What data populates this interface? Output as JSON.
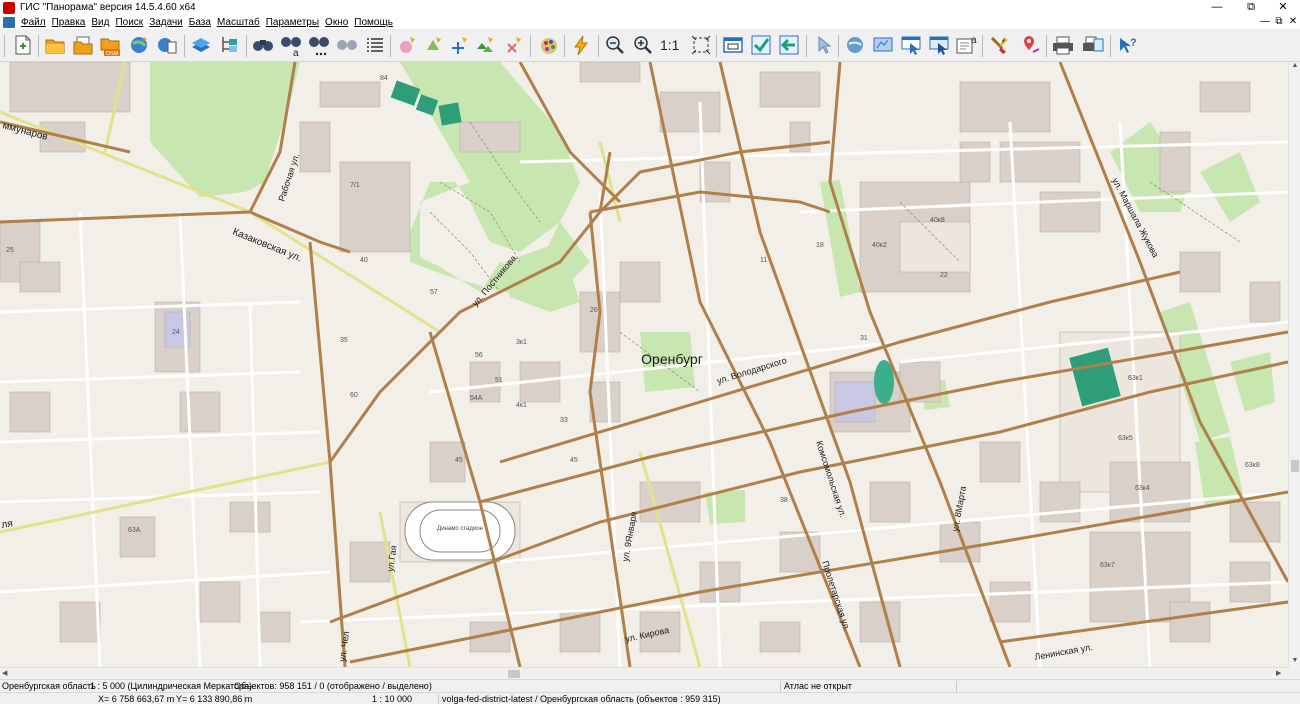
{
  "window": {
    "title": "ГИС \"Панорама\" версия 14.5.4.60 x64",
    "minimize": "—",
    "maximize": "⧉",
    "close": "✕"
  },
  "menu": {
    "items": [
      "Файл",
      "Правка",
      "Вид",
      "Поиск",
      "Задачи",
      "База",
      "Масштаб",
      "Параметры",
      "Окно",
      "Помощь"
    ],
    "child_minimize": "—",
    "child_restore": "⧉",
    "child_close": "✕"
  },
  "toolbar": {
    "zoom_one_to_one": "1:1",
    "osm_badge": "OSM",
    "icons": [
      "new-icon",
      "open-folder-icon",
      "open-folders-icon",
      "open-osm-icon",
      "globe-refresh-icon",
      "globe-docs-icon",
      "layers-icon",
      "legend-tree-icon",
      "search-binoculars-icon",
      "search-text-icon",
      "search-binoculars-dots-icon",
      "search-binoculars-grey-icon",
      "list-icon",
      "select-area-icon",
      "select-object-icon",
      "add-point-icon",
      "select-multiple-icon",
      "delete-object-icon",
      "palette-icon",
      "lightning-icon",
      "zoom-out-icon",
      "zoom-in-icon",
      "fit-window-icon",
      "window-frame-icon",
      "check-icon",
      "back-arrow-icon",
      "pointer-icon",
      "globe-arrows-icon",
      "map-arrow-icon",
      "pointer-window-icon",
      "pointer-window-blue-icon",
      "text-frame-icon",
      "brush-icon",
      "pin-route-icon",
      "print-icon",
      "print-preview-icon",
      "help-pointer-icon"
    ]
  },
  "map": {
    "city_label": "Оренбург",
    "streets": {
      "kommunarov": "ммунаров",
      "kazakovskaya": "Казаковская ул.",
      "rabochaya": "Рабочая ул.",
      "postnikova": "ул. Постникова",
      "volodarskogo": "ул. Володарского",
      "komsomolskaya": "Комсомольская ул.",
      "proletarskaya": "Пролетарская ул.",
      "yanvarya": "ул. 9Января",
      "maya": "ул. 8Марта",
      "gaya": "ул.Гая",
      "kirova": "ул. Кирова",
      "cheluskintsev": "ул. Чел",
      "leninskaya": "Ленинская ул.",
      "marshala": "ул. Маршала Жукова",
      "edge_label": "ля"
    },
    "stadium_label": "Динамо стадион",
    "house_numbers": [
      "84",
      "7/1",
      "40",
      "57",
      "24",
      "25",
      "45",
      "56",
      "51",
      "54А",
      "4к1",
      "3к1",
      "35",
      "60",
      "33",
      "45",
      "63А",
      "40к8",
      "40к2",
      "22",
      "31",
      "63к1",
      "63к5",
      "63к4",
      "63к7",
      "63к8",
      "18",
      "26",
      "11",
      "38"
    ],
    "colors": {
      "background": "#f2efe9",
      "building": "#d9d0c9",
      "park": "#c8e6b0",
      "main_road": "#b07f4a",
      "yellow_road": "#dcdc6e",
      "sports": "#2e9e7a",
      "school": "#c8c8e6"
    }
  },
  "status": {
    "region_line": "Оренбургская область",
    "scale_line": "1 : 5 000 (Цилиндрическая Меркатора)",
    "objects_line": "Объектов: 958 151 / 0 (отображено / выделено)",
    "atlas": "Атлас не открыт",
    "x_coord": "X= 6 758 663,67 m",
    "y_coord": "Y= 6 133 890,86 m",
    "scale": "1 : 10 000",
    "dataset": "volga-fed-district-latest / Оренбургская область   (объектов : 959 315)"
  }
}
